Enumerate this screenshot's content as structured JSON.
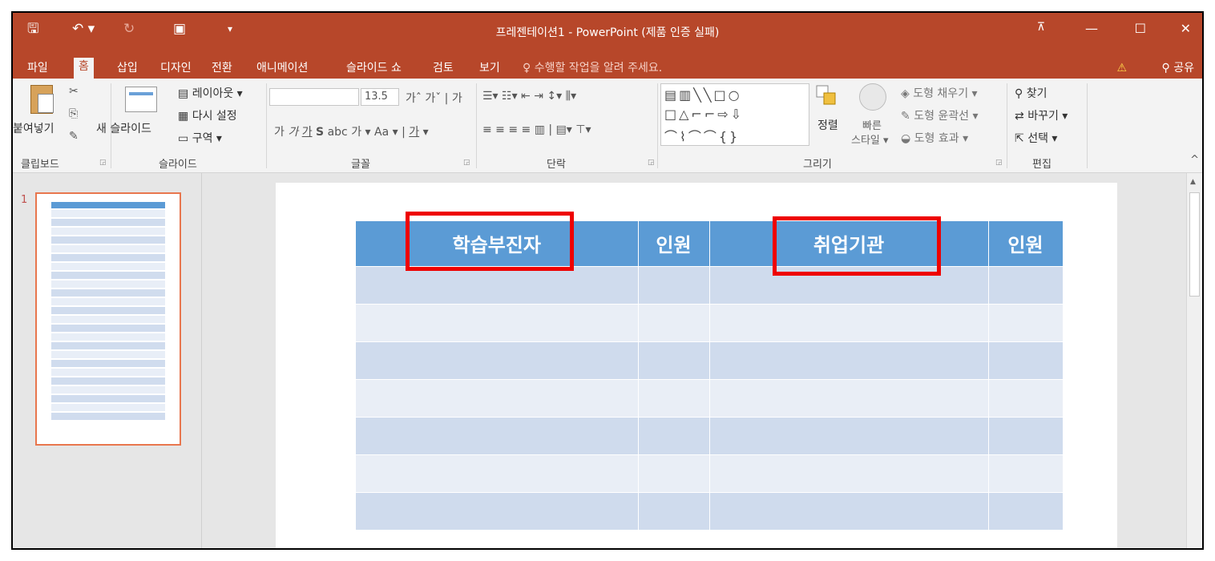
{
  "window": {
    "title": "프레젠테이션1 - PowerPoint (제품 인증 실패)",
    "icons": {
      "save": "save-icon",
      "undo": "undo-icon",
      "redo": "redo-icon",
      "slideshow": "present-icon",
      "customize": "dropdown-icon"
    },
    "controls": {
      "ribbon_display": "ribbon-display-icon",
      "minimize": "minimize-icon",
      "maximize": "maximize-icon",
      "close": "close-icon"
    }
  },
  "tabs": [
    {
      "label": "파일"
    },
    {
      "label": "홈"
    },
    {
      "label": "삽입"
    },
    {
      "label": "디자인"
    },
    {
      "label": "전환"
    },
    {
      "label": "애니메이션"
    },
    {
      "label": "슬라이드 쇼"
    },
    {
      "label": "검토"
    },
    {
      "label": "보기"
    }
  ],
  "active_tab": "홈",
  "tell_me": "수행할 작업을 알려 주세요.",
  "share": "공유",
  "ribbon": {
    "clipboard": {
      "label": "클립보드",
      "paste": "붙여넣기"
    },
    "slides": {
      "label": "슬라이드",
      "new_slide": "새 슬라이드",
      "layout": "레이아웃 ▾",
      "reset": "다시 설정",
      "section": "구역 ▾"
    },
    "font": {
      "label": "글꼴",
      "font_name": "",
      "font_size": "13.5"
    },
    "paragraph": {
      "label": "단락"
    },
    "drawing": {
      "label": "그리기",
      "arrange": "정렬",
      "quick_styles_1": "빠른",
      "quick_styles_2": "스타일 ▾",
      "fill": "도형 채우기 ▾",
      "outline": "도형 윤곽선 ▾",
      "effects": "도형 효과 ▾"
    },
    "editing": {
      "label": "편집",
      "find": "찾기",
      "replace": "바꾸기 ▾",
      "select": "선택 ▾"
    }
  },
  "slide_panel": {
    "slide_number": "1"
  },
  "table": {
    "headers": [
      "학습부진자",
      "인원",
      "취업기관",
      "인원"
    ],
    "row_count": 7
  },
  "colors": {
    "brand": "#b7472a",
    "table_header": "#5b9bd5",
    "row_odd": "#cfdbed",
    "row_even": "#e9eef6",
    "highlight": "#ee0000"
  }
}
